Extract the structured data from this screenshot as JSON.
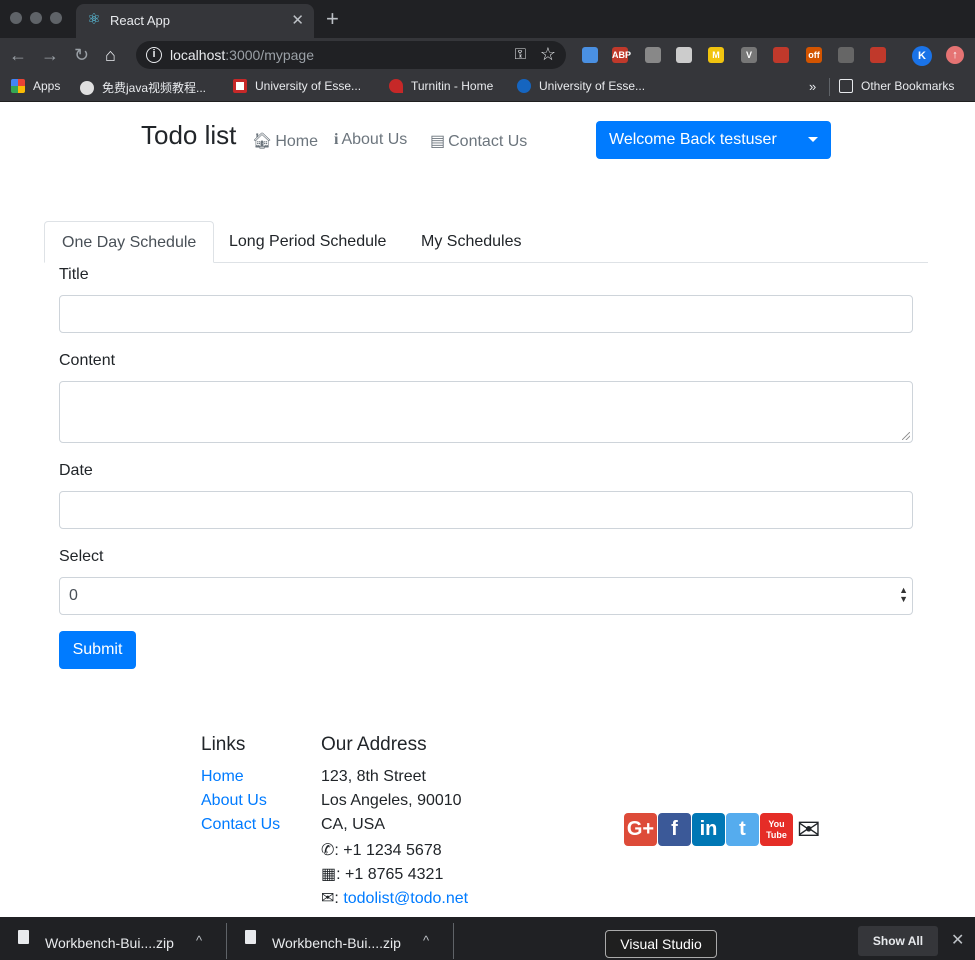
{
  "browser": {
    "tab_title": "React App",
    "url_host": "localhost",
    "url_path": ":3000/mypage",
    "extensions": [
      {
        "name": "mail-extension-icon",
        "label": "",
        "color": "#4a90e2"
      },
      {
        "name": "adblock-icon",
        "label": "ABP",
        "color": "#c0392b"
      },
      {
        "name": "camera-icon",
        "label": "",
        "color": "#888888"
      },
      {
        "name": "pen-icon",
        "label": "",
        "color": "#cccccc"
      },
      {
        "name": "m-extension-icon",
        "label": "M",
        "color": "#f1c40f"
      },
      {
        "name": "v-extension-icon",
        "label": "V",
        "color": "#777777"
      },
      {
        "name": "pdf-icon",
        "label": "",
        "color": "#c0392b"
      },
      {
        "name": "off-extension-icon",
        "label": "off",
        "color": "#d35400"
      },
      {
        "name": "tool-extension-icon",
        "label": "",
        "color": "#666666"
      },
      {
        "name": "record-extension-icon",
        "label": "",
        "color": "#c0392b"
      }
    ],
    "profile_initial": "K",
    "bookmarks": [
      {
        "label": "Apps"
      },
      {
        "label": "免费java视频教程..."
      },
      {
        "label": "University of Esse..."
      },
      {
        "label": "Turnitin - Home"
      },
      {
        "label": "University of Esse..."
      }
    ],
    "bookmarks_overflow": "»",
    "other_bookmarks": "Other Bookmarks"
  },
  "navbar": {
    "brand": "Todo list",
    "links": [
      "Home",
      "About Us",
      "Contact Us"
    ],
    "welcome": "Welcome Back testuser"
  },
  "tabs": [
    "One Day Schedule",
    "Long Period Schedule",
    "My Schedules"
  ],
  "form": {
    "title_label": "Title",
    "title_value": "",
    "content_label": "Content",
    "content_value": "",
    "date_label": "Date",
    "date_value": "",
    "select_label": "Select",
    "select_value": "0",
    "submit": "Submit"
  },
  "footer": {
    "links_heading": "Links",
    "links": [
      "Home",
      "About Us",
      "Contact Us"
    ],
    "address_heading": "Our Address",
    "address_lines": [
      "123, 8th Street",
      "Los Angeles, 90010",
      "CA, USA"
    ],
    "phone": ": +1 1234 5678",
    "fax": ": +1 8765 4321",
    "email_prefix": ":",
    "email": "todolist@todo.net",
    "social": [
      {
        "name": "google-plus-icon",
        "glyph": "G+",
        "color": "#dd4b39"
      },
      {
        "name": "facebook-icon",
        "glyph": "f",
        "color": "#3b5998"
      },
      {
        "name": "linkedin-icon",
        "glyph": "in",
        "color": "#0077b5"
      },
      {
        "name": "twitter-icon",
        "glyph": "t",
        "color": "#55acee"
      },
      {
        "name": "youtube-icon",
        "glyph": "You Tube",
        "color": "#e52d27"
      }
    ]
  },
  "downloads": {
    "items": [
      "Workbench-Bui....zip",
      "Workbench-Bui....zip"
    ],
    "tooltip": "Visual Studio",
    "show_all": "Show All"
  }
}
